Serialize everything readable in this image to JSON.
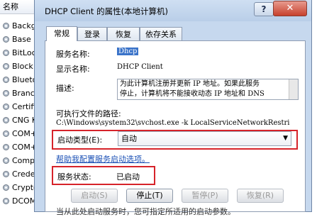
{
  "background_list": {
    "header": "名称",
    "items": [
      "Backgro",
      "Base Fil",
      "BitLock",
      "Block L",
      "Bluetoo",
      "BranchC",
      "Certifica",
      "CNG Ke",
      "COM+ ",
      "COM+ ",
      "Compu",
      "Creden",
      "Cryptog",
      "DCOM"
    ]
  },
  "dialog": {
    "title": "DHCP Client 的属性(本地计算机)",
    "help_label": "?",
    "close_label": "✕",
    "tabs": [
      "常规",
      "登录",
      "恢复",
      "依存关系"
    ],
    "service_name_label": "服务名称:",
    "service_name_value": "Dhcp",
    "display_name_label": "显示名称:",
    "display_name_value": "DHCP Client",
    "description_label": "描述:",
    "description_line1": "为此计算机注册并更新 IP 地址。如果此服务",
    "description_line2": "停止，计算机将不能接收动态 IP 地址和 DNS",
    "path_label": "可执行文件的路径:",
    "path_value": "C:\\Windows\\system32\\svchost.exe -k LocalServiceNetworkRestri",
    "startup_type_label": "启动类型(E):",
    "startup_type_value": "自动",
    "config_link": "帮助我配置服务启动选项。",
    "status_label": "服务状态:",
    "status_value": "已启动",
    "buttons": {
      "start": "启动(S)",
      "stop": "停止(T)",
      "pause": "暂停(P)",
      "resume": "恢复(R)"
    },
    "bottom_text": "当从此处启动服务时，您可指定所适用的启动参数。"
  },
  "colors": {
    "highlight_border": "#d6232a",
    "selection": "#3a73c9",
    "link": "#1a4fb5"
  }
}
